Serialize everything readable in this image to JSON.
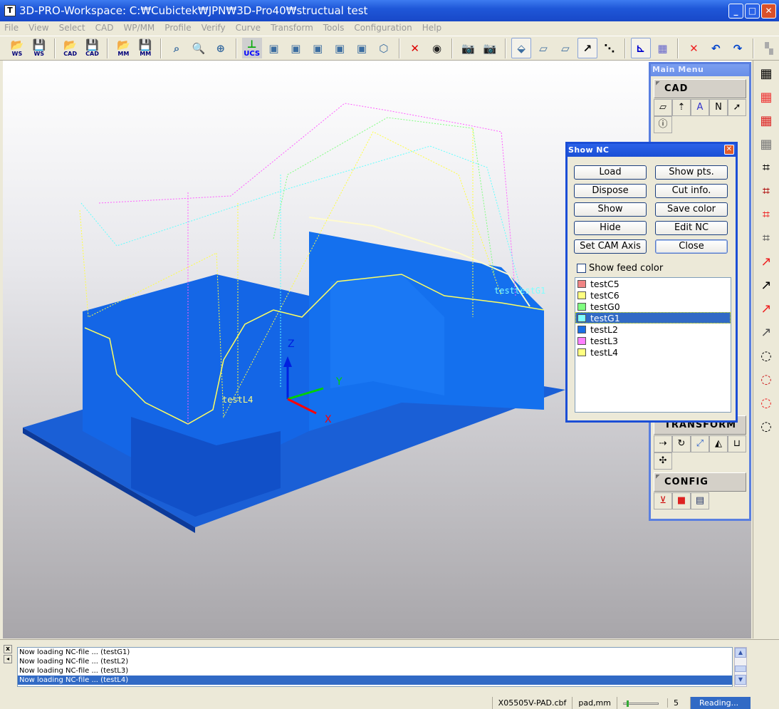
{
  "window": {
    "title": "3D-PRO-Workspace: C:₩Cubictek₩JPN₩3D-Pro40₩structual test",
    "app_icon": "T"
  },
  "menu": [
    "File",
    "View",
    "Select",
    "CAD",
    "WP/MM",
    "Profile",
    "Verify",
    "Curve",
    "Transform",
    "Tools",
    "Configuration",
    "Help"
  ],
  "toolbar": {
    "ws_open": "WS",
    "ws_save": "WS",
    "cad_open": "CAD",
    "cad_save": "CAD",
    "mm_open": "MM",
    "mm_save": "MM",
    "ucs": "UCS"
  },
  "viewport": {
    "labels": {
      "z": "Z",
      "y": "Y",
      "x": "X",
      "testG1": "testtestG1",
      "testL4": "testL4"
    },
    "colors": {
      "model": "#1466e6",
      "base": "#1a60d8"
    }
  },
  "main_menu": {
    "title": "Main Menu",
    "sections": [
      "CAD",
      "TRANSFORM",
      "CONFIG"
    ]
  },
  "show_nc": {
    "title": "Show NC",
    "buttons": {
      "load": "Load",
      "show_pts": "Show pts.",
      "dispose": "Dispose",
      "cut_info": "Cut info.",
      "show": "Show",
      "save_color": "Save color",
      "hide": "Hide",
      "edit_nc": "Edit NC",
      "set_cam_axis": "Set CAM Axis",
      "close": "Close"
    },
    "show_feed_color": {
      "label": "Show feed color",
      "checked": false
    },
    "items": [
      {
        "name": "testC5",
        "color": "#f08484"
      },
      {
        "name": "testC6",
        "color": "#ffff80"
      },
      {
        "name": "testG0",
        "color": "#80ff80"
      },
      {
        "name": "testG1",
        "color": "#80ffff"
      },
      {
        "name": "testL2",
        "color": "#1a6ee6"
      },
      {
        "name": "testL3",
        "color": "#ff80ff"
      },
      {
        "name": "testL4",
        "color": "#ffff80"
      }
    ],
    "selected": "testG1"
  },
  "log": {
    "lines": [
      "Now loading NC-file ... (testG1)",
      "Now loading NC-file ... (testL2)",
      "Now loading NC-file ... (testL3)",
      "Now loading NC-file ... (testL4)"
    ]
  },
  "status": {
    "file": "X05505V-PAD.cbf",
    "units": "pad,mm",
    "slider_value": "5",
    "state": "Reading..."
  }
}
